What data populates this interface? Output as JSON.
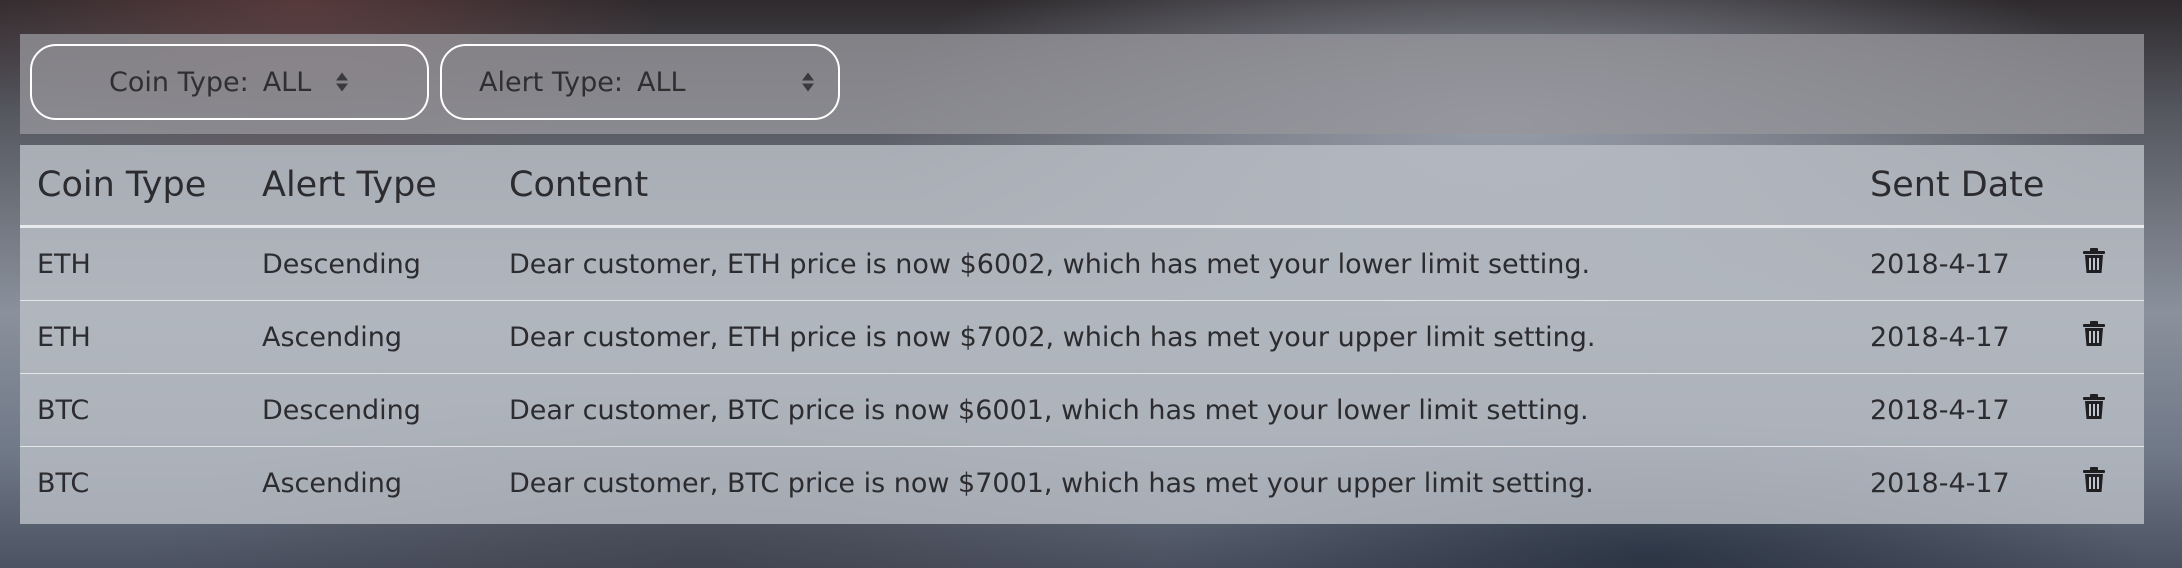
{
  "filters": {
    "coin_type": {
      "label": "Coin Type:",
      "value": "ALL"
    },
    "alert_type": {
      "label": "Alert Type:",
      "value": "ALL"
    }
  },
  "table": {
    "headers": [
      "Coin Type",
      "Alert Type",
      "Content",
      "Sent Date"
    ],
    "rows": [
      {
        "coin": "ETH",
        "alert": "Descending",
        "content": "Dear customer, ETH price is now $6002, which has met your lower limit setting.",
        "date": "2018-4-17"
      },
      {
        "coin": "ETH",
        "alert": "Ascending",
        "content": "Dear customer, ETH price is now $7002, which has met your upper limit setting.",
        "date": "2018-4-17"
      },
      {
        "coin": "BTC",
        "alert": "Descending",
        "content": "Dear customer, BTC price is now $6001, which has met your lower limit setting.",
        "date": "2018-4-17"
      },
      {
        "coin": "BTC",
        "alert": "Ascending",
        "content": "Dear customer, BTC price is now $7001, which has met your upper limit setting.",
        "date": "2018-4-17"
      }
    ],
    "row_action_icon": "trash-icon"
  }
}
